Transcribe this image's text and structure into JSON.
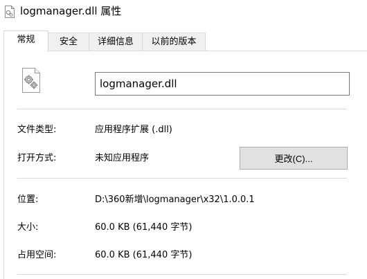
{
  "window": {
    "title": "logmanager.dll 属性"
  },
  "tabs": [
    {
      "label": "常规",
      "active": true
    },
    {
      "label": "安全",
      "active": false
    },
    {
      "label": "详细信息",
      "active": false
    },
    {
      "label": "以前的版本",
      "active": false
    }
  ],
  "general": {
    "file_name": "logmanager.dll",
    "file_type_label": "文件类型:",
    "file_type_value": "应用程序扩展 (.dll)",
    "opens_with_label": "打开方式:",
    "opens_with_value": "未知应用程序",
    "change_button_label": "更改(C)...",
    "location_label": "位置:",
    "location_value": "D:\\360新增\\logmanager\\x32\\1.0.0.1",
    "size_label": "大小:",
    "size_value": "60.0 KB (61,440 字节)",
    "size_on_disk_label": "占用空间:",
    "size_on_disk_value": "60.0 KB (61,440 字节)"
  },
  "icons": {
    "title_icon": "dll-file-icon",
    "file_icon": "dll-file-gears-icon"
  }
}
